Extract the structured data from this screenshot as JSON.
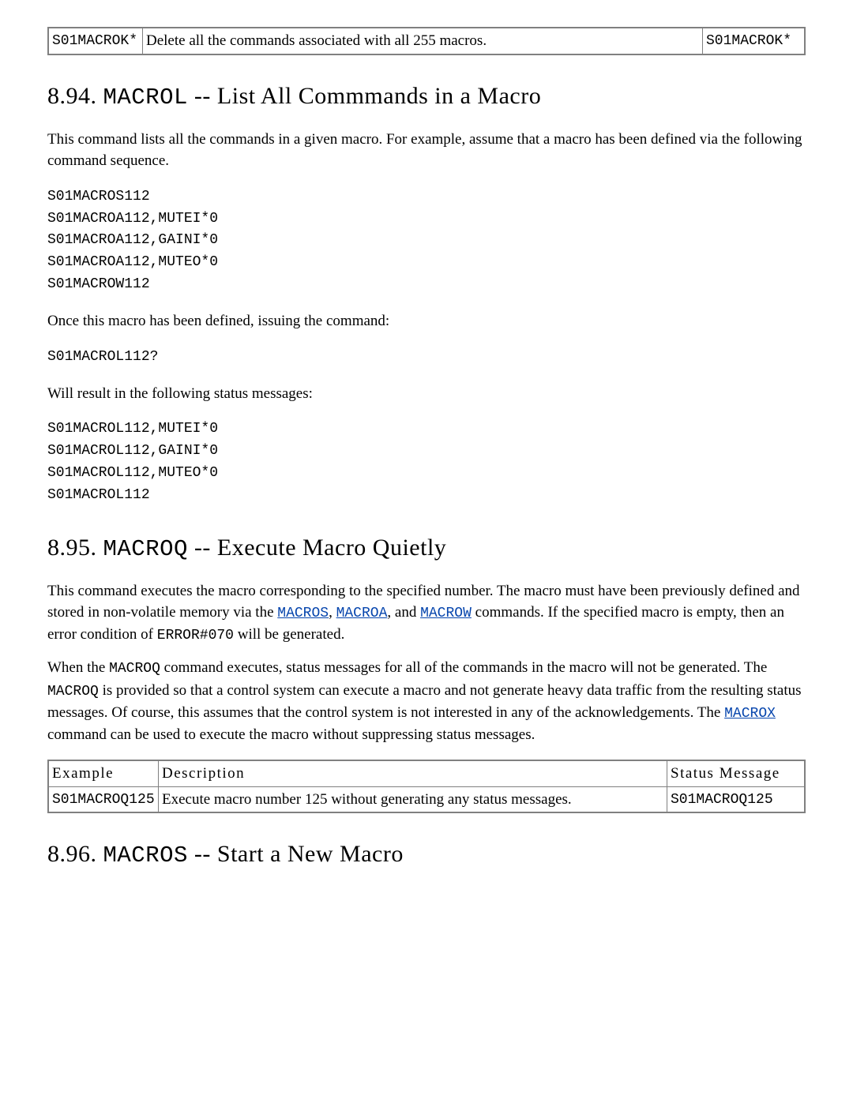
{
  "top_table": {
    "col1": "S01MACROK*",
    "col2": "Delete all the commands associated with all 255 macros.",
    "col3": "S01MACROK*"
  },
  "sec94": {
    "number": "8.94.",
    "cmd": "MACROL",
    "title_suffix": " -- List All Commmands in a Macro",
    "p1": "This command lists all the commands in a given macro. For example, assume that a macro has been defined via the following command sequence.",
    "code1": "S01MACROS112\nS01MACROA112,MUTEI*0\nS01MACROA112,GAINI*0\nS01MACROA112,MUTEO*0\nS01MACROW112",
    "p2": "Once this macro has been defined, issuing the command:",
    "code2": "S01MACROL112?",
    "p3": "Will result in the following status messages:",
    "code3": "S01MACROL112,MUTEI*0\nS01MACROL112,GAINI*0\nS01MACROL112,MUTEO*0\nS01MACROL112"
  },
  "sec95": {
    "number": "8.95.",
    "cmd": "MACROQ",
    "title_suffix": " -- Execute Macro Quietly",
    "p1a": "This command executes the macro corresponding to the specified number. The macro must have been previously defined and stored in non-volatile memory via the ",
    "link_macros": "MACROS",
    "sep1": ", ",
    "link_macroa": "MACROA",
    "sep2": ", and ",
    "link_macrow": "MACROW",
    "p1b": " commands. If the specified macro is empty, then an error condition of ",
    "error_code": "ERROR#070",
    "p1c": " will be generated.",
    "p2a": "When the ",
    "p2_cmd1": "MACROQ",
    "p2b": " command executes, status messages for all of the commands in the macro will not be generated. The ",
    "p2_cmd2": "MACROQ",
    "p2c": " is provided so that a control system can execute a macro and not generate heavy data traffic from the resulting status messages. Of course, this assumes that the control system is not interested in any of the acknowledgements. The ",
    "link_macrox": "MACROX",
    "p2d": " command can be used to execute the macro without suppressing status messages.",
    "table": {
      "h1": "Example",
      "h2": "Description",
      "h3": "Status Message",
      "r1c1": "S01MACROQ125",
      "r1c2": "Execute macro number 125 without generating any status messages.",
      "r1c3": "S01MACROQ125"
    }
  },
  "sec96": {
    "number": "8.96.",
    "cmd": "MACROS",
    "title_suffix": " -- Start a New Macro"
  }
}
